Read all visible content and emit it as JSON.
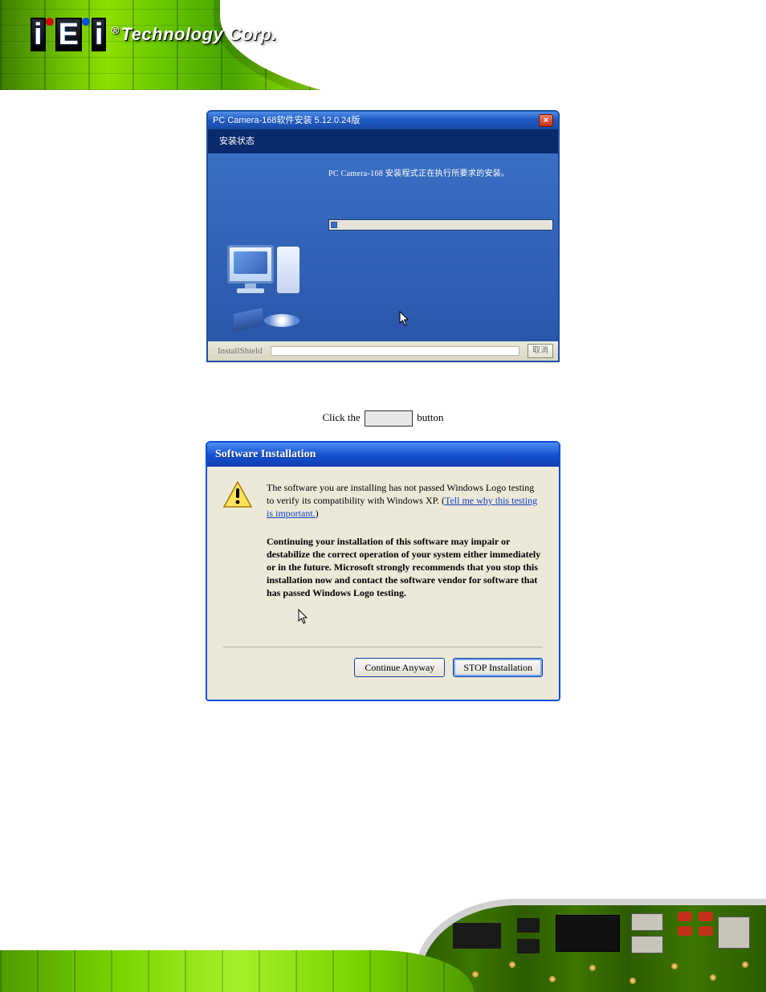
{
  "logo": {
    "brand_letters": "iEi",
    "tagline": "Technology Corp.",
    "registered": "®"
  },
  "win1": {
    "title": "PC Camera-168软件安装 5.12.0.24版",
    "subtitle": "安装状态",
    "message": "PC Camera-168 安装程式正在执行所要求的安装。",
    "footer_brand": "InstallShield",
    "footer_button": "取消",
    "close_glyph": "×"
  },
  "instruction": {
    "before": "Click the ",
    "after": " button"
  },
  "win2": {
    "title": "Software Installation",
    "para1_a": "The software you are installing has not passed Windows Logo testing to verify its compatibility with Windows XP. (",
    "link": "Tell me why this testing is important.",
    "para1_b": ")",
    "para2": "Continuing your installation of this software may impair or destabilize the correct operation of your system either immediately or in the future. Microsoft strongly recommends that you stop this installation now and contact the software vendor for software that has passed Windows Logo testing.",
    "btn_continue": "Continue Anyway",
    "btn_stop": "STOP Installation"
  }
}
